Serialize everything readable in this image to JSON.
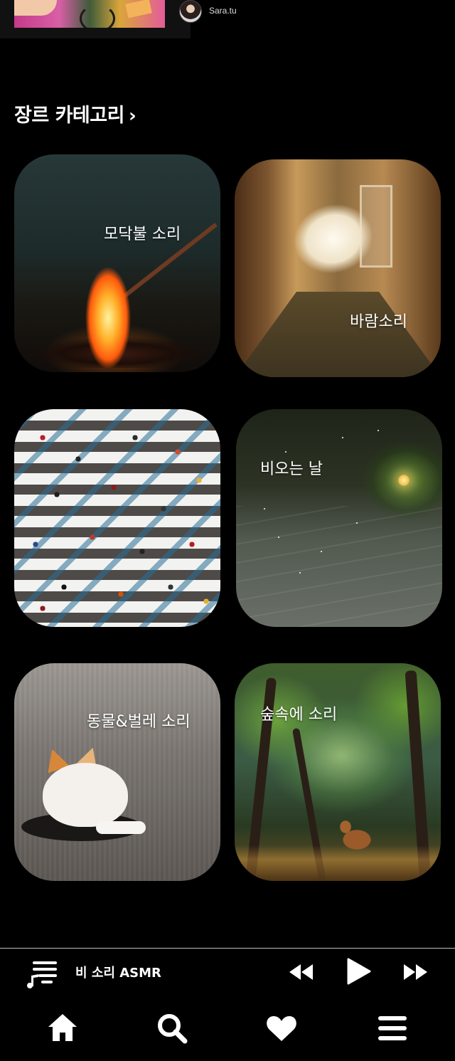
{
  "top": {
    "username": "Sara.tu"
  },
  "section": {
    "title": "장르 카테고리",
    "chevron": "›"
  },
  "categories": [
    {
      "label": "모닥불 소리",
      "image": "campfire"
    },
    {
      "label": "바람소리",
      "image": "curtain-in-hallway"
    },
    {
      "label": "",
      "image": "crosswalk-crowd"
    },
    {
      "label": "비오는 날",
      "image": "rainy-steps"
    },
    {
      "label": "동물&벌레 소리",
      "image": "cat-in-road"
    },
    {
      "label": "숲속에 소리",
      "image": "deer-in-forest"
    }
  ],
  "player": {
    "now_playing": "비 소리 ASMR",
    "icons": [
      "queue-music-icon",
      "previous-icon",
      "play-icon",
      "next-icon"
    ]
  },
  "nav": {
    "icons": [
      "home-icon",
      "search-icon",
      "heart-icon",
      "menu-icon"
    ]
  }
}
